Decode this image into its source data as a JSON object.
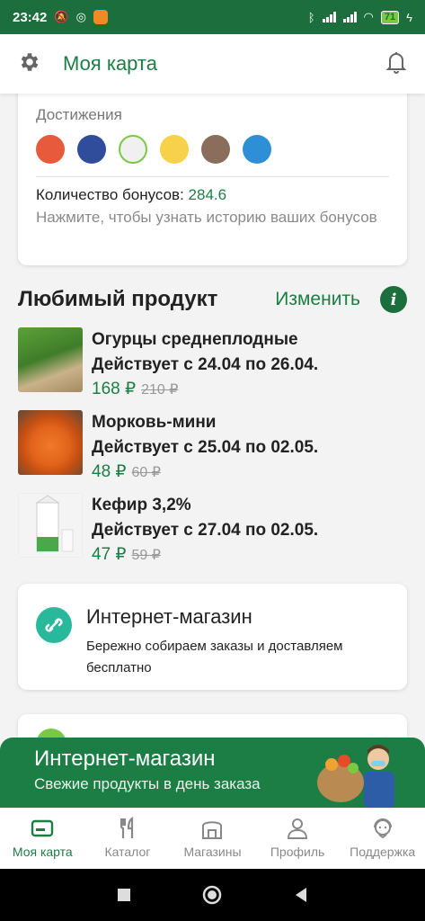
{
  "status_bar": {
    "time": "23:42",
    "battery": "71"
  },
  "header": {
    "title": "Моя карта"
  },
  "achievements": {
    "label": "Достижения",
    "icons": [
      "badge-doctor-icon",
      "badge-cat-icon",
      "badge-chef-icon",
      "badge-cashier-icon",
      "badge-vendor-icon",
      "badge-runner-icon"
    ],
    "bonus_label": "Количество бонусов: ",
    "bonus_value": "284.6",
    "bonus_hint": "Нажмите, чтобы узнать историю ваших бонусов"
  },
  "favorite": {
    "title": "Любимый продукт",
    "edit_label": "Изменить",
    "info_glyph": "i",
    "products": [
      {
        "name": "Огурцы среднеплодные",
        "dates": "Действует с 24.04 по 26.04.",
        "price_new": "168 ₽",
        "price_old": "210 ₽"
      },
      {
        "name": "Морковь-мини",
        "dates": "Действует с 25.04 по 02.05.",
        "price_new": "48 ₽",
        "price_old": "60 ₽"
      },
      {
        "name": "Кефир 3,2%",
        "dates": "Действует с 27.04 по 02.05.",
        "price_new": "47 ₽",
        "price_old": "59 ₽"
      }
    ]
  },
  "online_shop_card": {
    "title": "Интернет-магазин",
    "subtitle": "Бережно собираем заказы и доставляем бесплатно"
  },
  "banner": {
    "title": "Интернет-магазин",
    "subtitle": "Свежие продукты в день заказа"
  },
  "bottom_nav": [
    {
      "label": "Моя карта",
      "icon": "card-icon",
      "active": true
    },
    {
      "label": "Каталог",
      "icon": "cutlery-icon",
      "active": false
    },
    {
      "label": "Магазины",
      "icon": "store-icon",
      "active": false
    },
    {
      "label": "Профиль",
      "icon": "profile-icon",
      "active": false
    },
    {
      "label": "Поддержка",
      "icon": "support-icon",
      "active": false
    }
  ],
  "colors": {
    "brand_green": "#1c7d45",
    "status_green": "#1c6e3c",
    "price_green": "#1c7d45"
  }
}
